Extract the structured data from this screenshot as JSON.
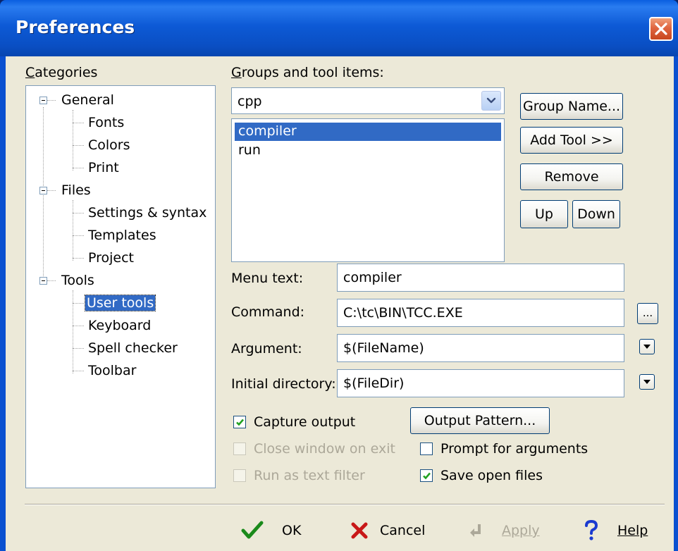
{
  "window": {
    "title": "Preferences"
  },
  "categories": {
    "label": "Categories",
    "groups": [
      {
        "label": "General",
        "children": [
          "Fonts",
          "Colors",
          "Print"
        ]
      },
      {
        "label": "Files",
        "children": [
          "Settings & syntax",
          "Templates",
          "Project"
        ]
      },
      {
        "label": "Tools",
        "children": [
          "User tools",
          "Keyboard",
          "Spell checker",
          "Toolbar"
        ]
      }
    ],
    "selected": "User tools"
  },
  "groups": {
    "label": "Groups and tool items:",
    "selected_group": "cpp",
    "items": [
      "compiler",
      "run"
    ],
    "selected_item": "compiler"
  },
  "side_buttons": {
    "group_name": "Group Name...",
    "add_tool": "Add Tool >>",
    "remove": "Remove",
    "up": "Up",
    "down": "Down"
  },
  "fields": {
    "menu_text": {
      "label": "Menu text:",
      "value": "compiler"
    },
    "command": {
      "label": "Command:",
      "value": "C:\\tc\\BIN\\TCC.EXE",
      "browse": "..."
    },
    "argument": {
      "label": "Argument:",
      "value": "$(FileName)"
    },
    "initial_directory": {
      "label": "Initial directory:",
      "value": "$(FileDir)"
    }
  },
  "options": {
    "capture_output": {
      "label": "Capture output",
      "checked": true,
      "enabled": true
    },
    "close_window": {
      "label": "Close window on exit",
      "checked": false,
      "enabled": false
    },
    "run_as_filter": {
      "label": "Run as text filter",
      "checked": false,
      "enabled": false
    },
    "prompt_args": {
      "label": "Prompt for arguments",
      "checked": false,
      "enabled": true
    },
    "save_open": {
      "label": "Save open files",
      "checked": true,
      "enabled": true
    },
    "output_pattern": "Output Pattern..."
  },
  "footer": {
    "ok": "OK",
    "cancel": "Cancel",
    "apply": "Apply",
    "help": "Help"
  },
  "colors": {
    "selection": "#316ac5",
    "dialog_bg": "#ece9d8",
    "titlebar": "#0a4fc4",
    "ok_check": "#1a8a1a",
    "cancel_x": "#c81818",
    "help_q": "#1a3ad0"
  }
}
